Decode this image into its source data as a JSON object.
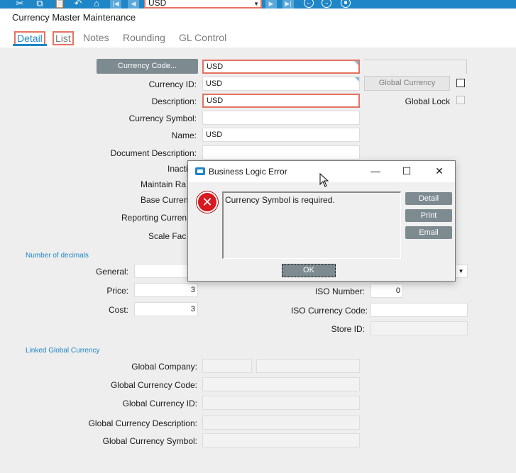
{
  "toolbar": {
    "combo_value": "USD"
  },
  "window": {
    "title": "Currency Master Maintenance"
  },
  "tabs": [
    {
      "label": "Detail"
    },
    {
      "label": "List"
    },
    {
      "label": "Notes"
    },
    {
      "label": "Rounding"
    },
    {
      "label": "GL Control"
    }
  ],
  "form": {
    "currency_code_button": "Currency Code...",
    "currency_code_value": "USD",
    "currency_id_label": "Currency ID:",
    "currency_id_value": "USD",
    "description_label": "Description:",
    "description_value": "USD",
    "currency_symbol_label": "Currency Symbol:",
    "currency_symbol_value": "",
    "name_label": "Name:",
    "name_value": "USD",
    "document_description_label": "Document Description:",
    "inactive_label": "Inacti",
    "maintain_rates_label": "Maintain Ra",
    "base_currency_label": "Base Curren",
    "reporting_currency_label": "Reporting Curren",
    "scale_factor_label": "Scale Fac",
    "global_currency_button": "Global Currency",
    "global_lock_label": "Global Lock"
  },
  "decimals": {
    "section_title": "Number of decimals",
    "general_label": "General:",
    "general_value": "",
    "price_label": "Price:",
    "price_value": "3",
    "cost_label": "Cost:",
    "cost_value": "3"
  },
  "iso": {
    "iso_number_label": "ISO Number:",
    "iso_number_value": "0",
    "iso_currency_code_label": "ISO Currency Code:",
    "iso_currency_code_value": "",
    "store_id_label": "Store ID:",
    "store_id_value": ""
  },
  "linked": {
    "section_title": "Linked Global Currency",
    "global_company_label": "Global Company:",
    "global_currency_code_label": "Global Currency Code:",
    "global_currency_id_label": "Global Currency ID:",
    "global_currency_description_label": "Global Currency Description:",
    "global_currency_symbol_label": "Global Currency Symbol:"
  },
  "dialog": {
    "title": "Business Logic Error",
    "message": "Currency Symbol is required.",
    "detail_button": "Detail",
    "print_button": "Print",
    "email_button": "Email",
    "ok_button": "OK"
  },
  "colors": {
    "accent": "#1f86c7",
    "error_outline": "#e57262",
    "button_gray": "#7d8a90",
    "error_icon": "#d71920"
  }
}
